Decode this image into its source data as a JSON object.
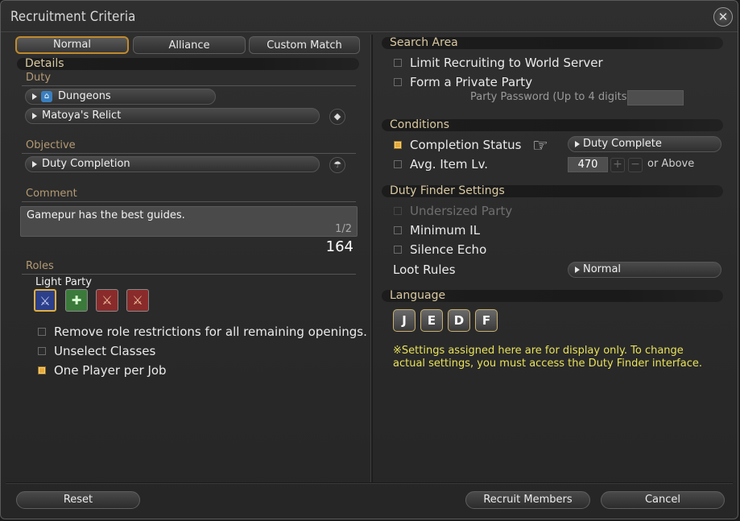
{
  "window": {
    "title": "Recruitment Criteria",
    "close_glyph": "✕"
  },
  "tabs": [
    {
      "label": "Normal",
      "active": true
    },
    {
      "label": "Alliance",
      "active": false
    },
    {
      "label": "Custom Match",
      "active": false
    }
  ],
  "details": {
    "heading": "Details",
    "duty_label": "Duty",
    "duty_category": "Dungeons",
    "duty_name": "Matoya's Relict",
    "objective_label": "Objective",
    "objective_value": "Duty Completion",
    "comment_label": "Comment",
    "comment_text": "Gamepur has the best guides.",
    "comment_counter": "1/2",
    "comment_chars_remaining": "164"
  },
  "roles": {
    "label": "Roles",
    "party_type": "Light Party",
    "slots": [
      {
        "role": "tank",
        "icon": "tank-role-icon"
      },
      {
        "role": "healer",
        "icon": "healer-role-icon"
      },
      {
        "role": "dps",
        "icon": "dps-role-icon"
      },
      {
        "role": "dps",
        "icon": "dps-role-icon"
      }
    ],
    "options": [
      {
        "label": "Remove role restrictions for all remaining openings.",
        "checked": false
      },
      {
        "label": "Unselect Classes",
        "checked": false
      },
      {
        "label": "One Player per Job",
        "checked": true
      }
    ]
  },
  "search_area": {
    "heading": "Search Area",
    "limit_world": {
      "label": "Limit Recruiting to World Server",
      "checked": false
    },
    "private_party": {
      "label": "Form a Private Party",
      "checked": false
    },
    "password_label": "Party Password (Up to 4 digits)",
    "password_value": ""
  },
  "conditions": {
    "heading": "Conditions",
    "completion_status": {
      "label": "Completion Status",
      "checked": true,
      "value": "Duty Complete"
    },
    "avg_item_lv": {
      "label": "Avg. Item Lv.",
      "checked": false,
      "value": "470",
      "suffix": "or Above"
    }
  },
  "duty_finder": {
    "heading": "Duty Finder Settings",
    "undersized": {
      "label": "Undersized Party",
      "checked": false,
      "disabled": true
    },
    "minimum_il": {
      "label": "Minimum IL",
      "checked": false
    },
    "silence_echo": {
      "label": "Silence Echo",
      "checked": false
    },
    "loot_rules_label": "Loot Rules",
    "loot_rules_value": "Normal"
  },
  "language": {
    "heading": "Language",
    "options": [
      "J",
      "E",
      "D",
      "F"
    ],
    "note": "※Settings assigned here are for display only. To change actual settings, you must access the Duty Finder interface."
  },
  "footer": {
    "reset": "Reset",
    "recruit": "Recruit Members",
    "cancel": "Cancel"
  },
  "colors": {
    "accent": "#c08a2d",
    "note": "#e8e25a",
    "label_gold": "#b49a74"
  }
}
